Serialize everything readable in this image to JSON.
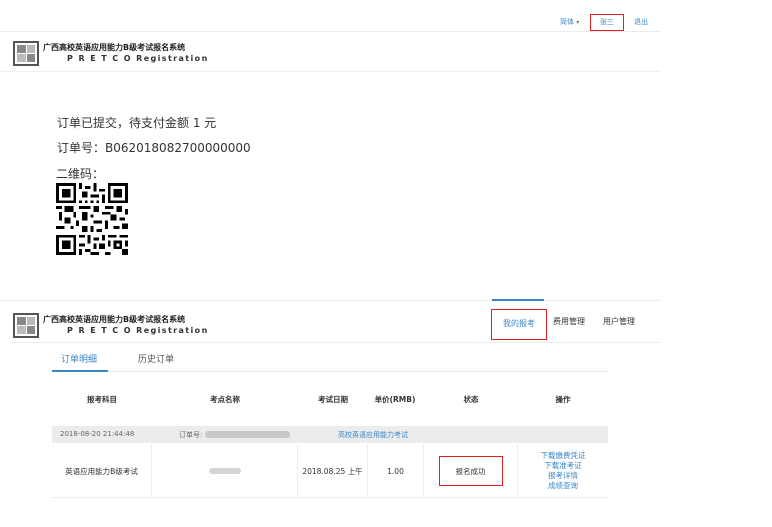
{
  "top_bar": {
    "language_label": "简体",
    "username": "张三",
    "logout_label": "退出"
  },
  "brand": {
    "name_cn": "广西高校英语应用能力B级考试报名系统",
    "name_en": "P R E T C O Registration"
  },
  "payment": {
    "status_text": "订单已提交，待支付金额 1 元",
    "order_no_label": "订单号：",
    "order_no": "B062018082700000000",
    "qr_label": "二维码："
  },
  "nav": {
    "my_registrations": "我的报考",
    "fee_management": "费用管理",
    "user_management": "用户管理"
  },
  "tabs": {
    "order_details": "订单明细",
    "order_history": "历史订单"
  },
  "table": {
    "headers": [
      "报考科目",
      "考点名称",
      "考试日期",
      "单价(RMB)",
      "状态",
      "操作"
    ],
    "order": {
      "datetime": "2018-08-20 21:44:48",
      "order_label": "订单号:",
      "exam_link": "高校英语应用能力考试"
    },
    "row": {
      "subject": "英语应用能力B级考试",
      "exam_date": "2018.08.25 上午",
      "price": "1.00",
      "status": "报名成功",
      "actions": [
        "下载缴费凭证",
        "下载准考证",
        "报考详情",
        "成绩查询"
      ]
    }
  },
  "colors": {
    "accent": "#3a86c8",
    "highlight": "#e02020"
  },
  "icons": {
    "brand_logo": "pretco-logo-icon",
    "qr": "qr-code-image"
  }
}
